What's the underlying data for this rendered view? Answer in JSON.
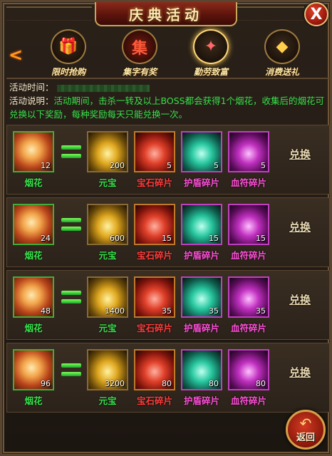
{
  "title": "庆典活动",
  "close_label": "X",
  "nav_prev": "<",
  "tabs": [
    {
      "label": "限时抢购",
      "icon": "gift-box-icon",
      "glyph": "🎁"
    },
    {
      "label": "集字有奖",
      "icon": "collect-char-icon",
      "glyph": "集"
    },
    {
      "label": "勤劳致富",
      "icon": "winged-crest-icon",
      "glyph": "✦"
    },
    {
      "label": "消费送礼",
      "icon": "gold-ingot-icon",
      "glyph": "◆"
    }
  ],
  "active_tab_index": 2,
  "info": {
    "time_label": "活动时间：",
    "desc_label": "活动说明：",
    "desc_text": "活动期间，击杀一转及以上BOSS都会获得1个烟花，收集后的烟花可兑换以下奖励，每种奖励每天只能兑换一次。"
  },
  "item_names": {
    "firework": "烟花",
    "ingot": "元宝",
    "gem": "宝石碎片",
    "shield": "护盾碎片",
    "rune": "血符碎片"
  },
  "colors": {
    "firework": "#36e04a",
    "ingot": "#36e04a",
    "gem": "#ff3b3b",
    "shield": "#ff4fd8",
    "rune": "#ff4fd8"
  },
  "exchange_label": "兑换",
  "rows": [
    {
      "firework_qty": "12",
      "ingot_qty": "200",
      "gem_qty": "5",
      "shield_qty": "5",
      "rune_qty": "5"
    },
    {
      "firework_qty": "24",
      "ingot_qty": "600",
      "gem_qty": "15",
      "shield_qty": "15",
      "rune_qty": "15"
    },
    {
      "firework_qty": "48",
      "ingot_qty": "1400",
      "gem_qty": "35",
      "shield_qty": "35",
      "rune_qty": "35"
    },
    {
      "firework_qty": "96",
      "ingot_qty": "3200",
      "gem_qty": "80",
      "shield_qty": "80",
      "rune_qty": "80"
    }
  ],
  "back_label": "返回"
}
